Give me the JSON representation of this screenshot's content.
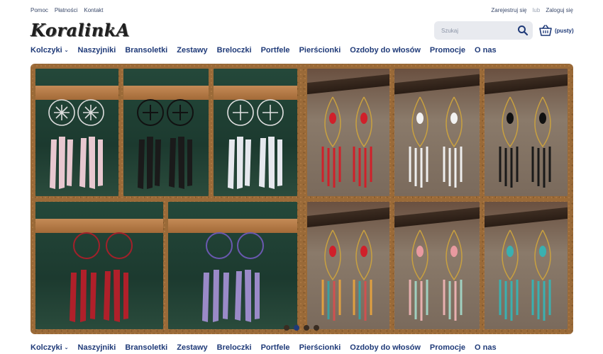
{
  "topbar": {
    "left_links": [
      "Pomoc",
      "Płatności",
      "Kontakt"
    ],
    "register": "Zarejestruj się",
    "or": "lub",
    "login": "Zaloguj się"
  },
  "logo": {
    "text": "KoralinkA"
  },
  "search": {
    "placeholder": "Szukaj",
    "icon": "search-icon"
  },
  "cart": {
    "label": "(pusty)",
    "icon": "basket-icon"
  },
  "nav": {
    "items": [
      "Kolczyki",
      "Naszyjniki",
      "Bransoletki",
      "Zestawy",
      "Breloczki",
      "Portfele",
      "Pierścionki",
      "Ozdoby do włosów",
      "Promocje",
      "O nas"
    ],
    "dropdown_item": "Kolczyki"
  },
  "slider": {
    "dot_count": 4,
    "active_index": 1
  },
  "colors": {
    "accent": "#1f3a78",
    "cork": "#9a6a38",
    "feather_pink": "#e8c8d0",
    "feather_black": "#1a1a1a",
    "feather_white": "#e6e8ee",
    "feather_red": "#b0202a",
    "feather_purple": "#9a8ac8"
  }
}
